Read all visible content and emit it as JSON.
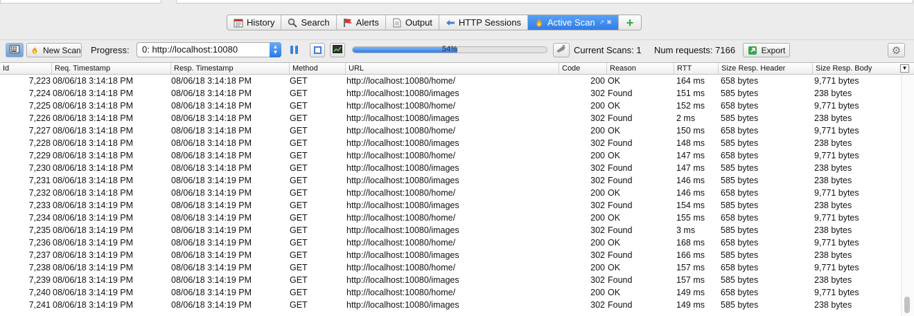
{
  "tabs": [
    {
      "label": "History",
      "icon": "history-icon"
    },
    {
      "label": "Search",
      "icon": "search-icon"
    },
    {
      "label": "Alerts",
      "icon": "alerts-flag-icon"
    },
    {
      "label": "Output",
      "icon": "output-document-icon"
    },
    {
      "label": "HTTP Sessions",
      "icon": "http-sessions-icon"
    },
    {
      "label": "Active Scan",
      "icon": "flame-icon",
      "active": true
    },
    {
      "label": "+",
      "icon": "add-tab-icon"
    }
  ],
  "toolbar": {
    "new_scan_label": "New Scan",
    "progress_label": "Progress:",
    "progress_select_value": "0: http://localhost:10080",
    "progress_percent": 54,
    "progress_text": "54%",
    "current_scans_label": "Current Scans: 1",
    "num_requests_label": "Num requests: 7166",
    "export_label": "Export"
  },
  "colors": {
    "accent": "#2f7ee8",
    "tab_active": "#4a90f0"
  },
  "table": {
    "columns": [
      "Id",
      "Req. Timestamp",
      "Resp. Timestamp",
      "Method",
      "URL",
      "Code",
      "Reason",
      "RTT",
      "Size Resp. Header",
      "Size Resp. Body"
    ],
    "rows": [
      [
        "7,223",
        "08/06/18 3:14:18 PM",
        "08/06/18 3:14:18 PM",
        "GET",
        "http://localhost:10080/home/",
        "200",
        "OK",
        "164 ms",
        "658 bytes",
        "9,771 bytes"
      ],
      [
        "7,224",
        "08/06/18 3:14:18 PM",
        "08/06/18 3:14:18 PM",
        "GET",
        "http://localhost:10080/images",
        "302",
        "Found",
        "151 ms",
        "585 bytes",
        "238 bytes"
      ],
      [
        "7,225",
        "08/06/18 3:14:18 PM",
        "08/06/18 3:14:18 PM",
        "GET",
        "http://localhost:10080/home/",
        "200",
        "OK",
        "152 ms",
        "658 bytes",
        "9,771 bytes"
      ],
      [
        "7,226",
        "08/06/18 3:14:18 PM",
        "08/06/18 3:14:18 PM",
        "GET",
        "http://localhost:10080/images",
        "302",
        "Found",
        "2 ms",
        "585 bytes",
        "238 bytes"
      ],
      [
        "7,227",
        "08/06/18 3:14:18 PM",
        "08/06/18 3:14:18 PM",
        "GET",
        "http://localhost:10080/home/",
        "200",
        "OK",
        "150 ms",
        "658 bytes",
        "9,771 bytes"
      ],
      [
        "7,228",
        "08/06/18 3:14:18 PM",
        "08/06/18 3:14:18 PM",
        "GET",
        "http://localhost:10080/images",
        "302",
        "Found",
        "148 ms",
        "585 bytes",
        "238 bytes"
      ],
      [
        "7,229",
        "08/06/18 3:14:18 PM",
        "08/06/18 3:14:18 PM",
        "GET",
        "http://localhost:10080/home/",
        "200",
        "OK",
        "147 ms",
        "658 bytes",
        "9,771 bytes"
      ],
      [
        "7,230",
        "08/06/18 3:14:18 PM",
        "08/06/18 3:14:18 PM",
        "GET",
        "http://localhost:10080/images",
        "302",
        "Found",
        "147 ms",
        "585 bytes",
        "238 bytes"
      ],
      [
        "7,231",
        "08/06/18 3:14:18 PM",
        "08/06/18 3:14:19 PM",
        "GET",
        "http://localhost:10080/images",
        "302",
        "Found",
        "146 ms",
        "585 bytes",
        "238 bytes"
      ],
      [
        "7,232",
        "08/06/18 3:14:18 PM",
        "08/06/18 3:14:19 PM",
        "GET",
        "http://localhost:10080/home/",
        "200",
        "OK",
        "146 ms",
        "658 bytes",
        "9,771 bytes"
      ],
      [
        "7,233",
        "08/06/18 3:14:19 PM",
        "08/06/18 3:14:19 PM",
        "GET",
        "http://localhost:10080/images",
        "302",
        "Found",
        "154 ms",
        "585 bytes",
        "238 bytes"
      ],
      [
        "7,234",
        "08/06/18 3:14:19 PM",
        "08/06/18 3:14:19 PM",
        "GET",
        "http://localhost:10080/home/",
        "200",
        "OK",
        "155 ms",
        "658 bytes",
        "9,771 bytes"
      ],
      [
        "7,235",
        "08/06/18 3:14:19 PM",
        "08/06/18 3:14:19 PM",
        "GET",
        "http://localhost:10080/images",
        "302",
        "Found",
        "3 ms",
        "585 bytes",
        "238 bytes"
      ],
      [
        "7,236",
        "08/06/18 3:14:19 PM",
        "08/06/18 3:14:19 PM",
        "GET",
        "http://localhost:10080/home/",
        "200",
        "OK",
        "168 ms",
        "658 bytes",
        "9,771 bytes"
      ],
      [
        "7,237",
        "08/06/18 3:14:19 PM",
        "08/06/18 3:14:19 PM",
        "GET",
        "http://localhost:10080/images",
        "302",
        "Found",
        "166 ms",
        "585 bytes",
        "238 bytes"
      ],
      [
        "7,238",
        "08/06/18 3:14:19 PM",
        "08/06/18 3:14:19 PM",
        "GET",
        "http://localhost:10080/home/",
        "200",
        "OK",
        "157 ms",
        "658 bytes",
        "9,771 bytes"
      ],
      [
        "7,239",
        "08/06/18 3:14:19 PM",
        "08/06/18 3:14:19 PM",
        "GET",
        "http://localhost:10080/images",
        "302",
        "Found",
        "157 ms",
        "585 bytes",
        "238 bytes"
      ],
      [
        "7,240",
        "08/06/18 3:14:19 PM",
        "08/06/18 3:14:19 PM",
        "GET",
        "http://localhost:10080/home/",
        "200",
        "OK",
        "149 ms",
        "658 bytes",
        "9,771 bytes"
      ],
      [
        "7,241",
        "08/06/18 3:14:19 PM",
        "08/06/18 3:14:19 PM",
        "GET",
        "http://localhost:10080/images",
        "302",
        "Found",
        "149 ms",
        "585 bytes",
        "238 bytes"
      ]
    ]
  }
}
